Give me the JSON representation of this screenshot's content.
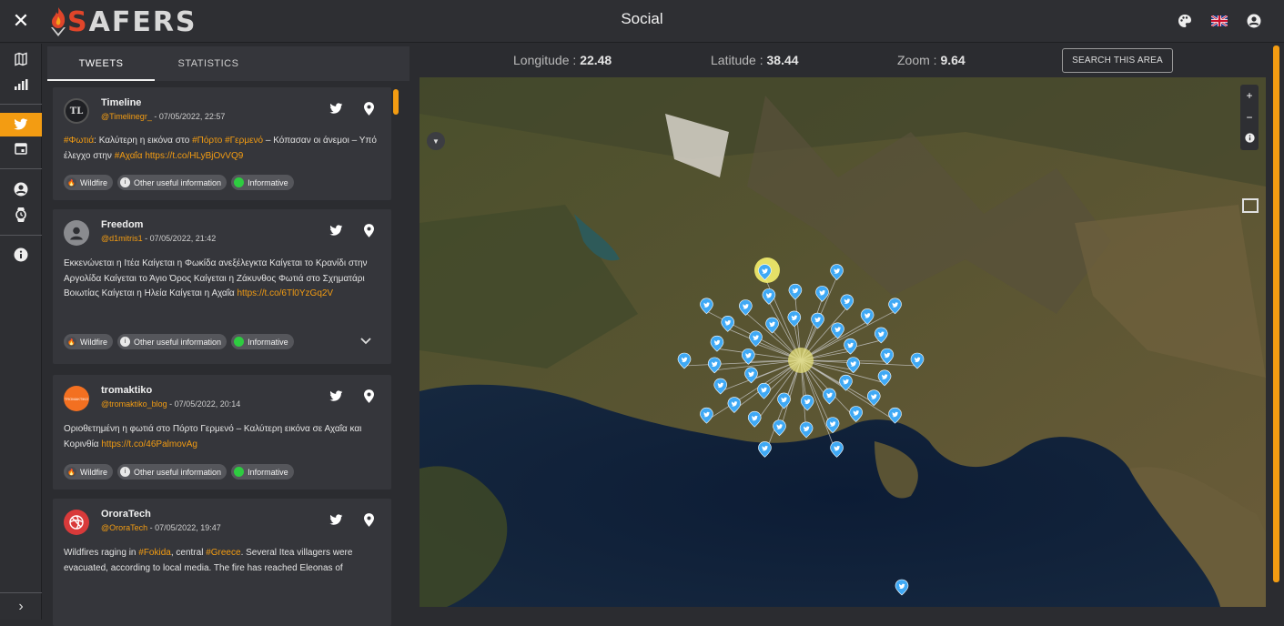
{
  "app": {
    "title": "Social",
    "logo_text": "AFERS",
    "logo_initial": "S"
  },
  "tabs": [
    {
      "label": "TWEETS"
    },
    {
      "label": "STATISTICS"
    }
  ],
  "map": {
    "longitude_label": "Longitude :",
    "longitude_value": "22.48",
    "latitude_label": "Latitude :",
    "latitude_value": "38.44",
    "zoom_label": "Zoom :",
    "zoom_value": "9.64",
    "search_button": "SEARCH THIS AREA",
    "zoom_in": "+",
    "zoom_out": "−"
  },
  "tweets": [
    {
      "name": "Timeline",
      "handle": "@Timelinegr_",
      "date": "07/05/2022, 22:57",
      "avatar": "TL",
      "segments": [
        {
          "t": "#Φωτιά",
          "hl": true
        },
        {
          "t": ": Καλύτερη η εικόνα στο ",
          "hl": false
        },
        {
          "t": "#Πόρτο",
          "hl": true
        },
        {
          "t": " ",
          "hl": false
        },
        {
          "t": "#Γερμενό",
          "hl": true
        },
        {
          "t": " – Κόπασαν οι άνεμοι – Υπό έλεγχο στην ",
          "hl": false
        },
        {
          "t": "#Αχαΐα",
          "hl": true
        },
        {
          "t": " ",
          "hl": false
        },
        {
          "t": "https://t.co/HLyBjOvVQ9",
          "hl": true
        }
      ],
      "chips": [
        "Wildfire",
        "Other useful information",
        "Informative"
      ]
    },
    {
      "name": "Freedom",
      "handle": "@d1mitris1",
      "date": "07/05/2022, 21:42",
      "avatar": "",
      "segments": [
        {
          "t": "Εκκενώνεται η Ιτέα Καίγεται η Φωκίδα ανεξέλεγκτα Καίγεται το Κρανίδι στην Αργολίδα Καίγεται το Άγιο Όρος Καίγεται η Ζάκυνθος Φωτιά στο Σχηματάρι Βοιωτίας Καίγεται η Ηλεία Καίγεται η Αχαΐα ",
          "hl": false
        },
        {
          "t": "https://t.co/6Tl0YzGq2V",
          "hl": true
        }
      ],
      "chips": [
        "Wildfire",
        "Other useful information",
        "Informative"
      ]
    },
    {
      "name": "tromaktiko",
      "handle": "@tromaktiko_blog",
      "date": "07/05/2022, 20:14",
      "avatar": "TROMAKTIKO",
      "segments": [
        {
          "t": "Οριοθετημένη η φωτιά στο Πόρτο Γερμενό – Καλύτερη εικόνα σε Αχαΐα και Κορινθία ",
          "hl": false
        },
        {
          "t": "https://t.co/46PalmovAg",
          "hl": true
        }
      ],
      "chips": [
        "Wildfire",
        "Other useful information",
        "Informative"
      ]
    },
    {
      "name": "OroraTech",
      "handle": "@OroraTech",
      "date": "07/05/2022, 19:47",
      "avatar": "",
      "segments": [
        {
          "t": "Wildfires raging in ",
          "hl": false
        },
        {
          "t": "#Fokida",
          "hl": true
        },
        {
          "t": ", central ",
          "hl": false
        },
        {
          "t": "#Greece",
          "hl": true
        },
        {
          "t": ". Several Itea villagers were evacuated, according to local media. The fire has reached Eleonas of",
          "hl": false
        }
      ],
      "chips": []
    }
  ],
  "colors": {
    "accent": "#f39c12",
    "marker": "#3fa9f5",
    "topbar": "#2e2f33"
  }
}
